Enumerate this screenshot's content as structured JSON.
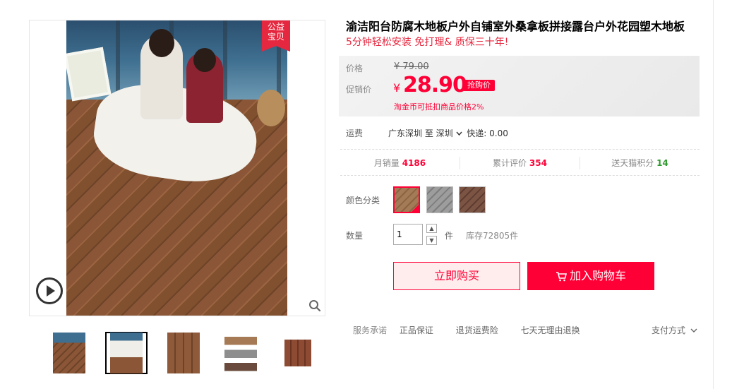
{
  "product": {
    "title": "渝洁阳台防腐木地板户外自铺室外桑拿板拼接露台户外花园塑木地板",
    "subtitle": "5分钟轻松安装 免打理& 质保三十年!"
  },
  "gallery": {
    "badge_line1": "公益",
    "badge_line2": "宝贝",
    "play_icon": "play-icon",
    "zoom_icon": "magnifier-icon",
    "active_thumb_index": 1
  },
  "price": {
    "orig_label": "价格",
    "orig_value": "¥ 79.00",
    "promo_label": "促销价",
    "currency": "¥",
    "promo_value": "28.90",
    "promo_tag": "抢购价",
    "coin_note": "淘金币可抵扣商品价格2%",
    "accent_color": "#ff0036"
  },
  "shipping": {
    "label": "运费",
    "route": "广东深圳  至  深圳",
    "fee": "快递: 0.00"
  },
  "stats": {
    "monthly_label": "月销量",
    "monthly_value": "4186",
    "reviews_label": "累计评价",
    "reviews_value": "354",
    "points_label": "送天猫积分",
    "points_value": "14"
  },
  "options": {
    "color_label": "颜色分类",
    "selected_index": 0
  },
  "quantity": {
    "label": "数量",
    "value": "1",
    "up": "▲",
    "down": "▼",
    "unit": "件",
    "stock": "库存72805件"
  },
  "buttons": {
    "buy": "立即购买",
    "cart": "加入购物车"
  },
  "services": {
    "label": "服务承诺",
    "item1": "正品保证",
    "item2": "退货运费险",
    "item3": "七天无理由退换",
    "payment": "支付方式"
  }
}
